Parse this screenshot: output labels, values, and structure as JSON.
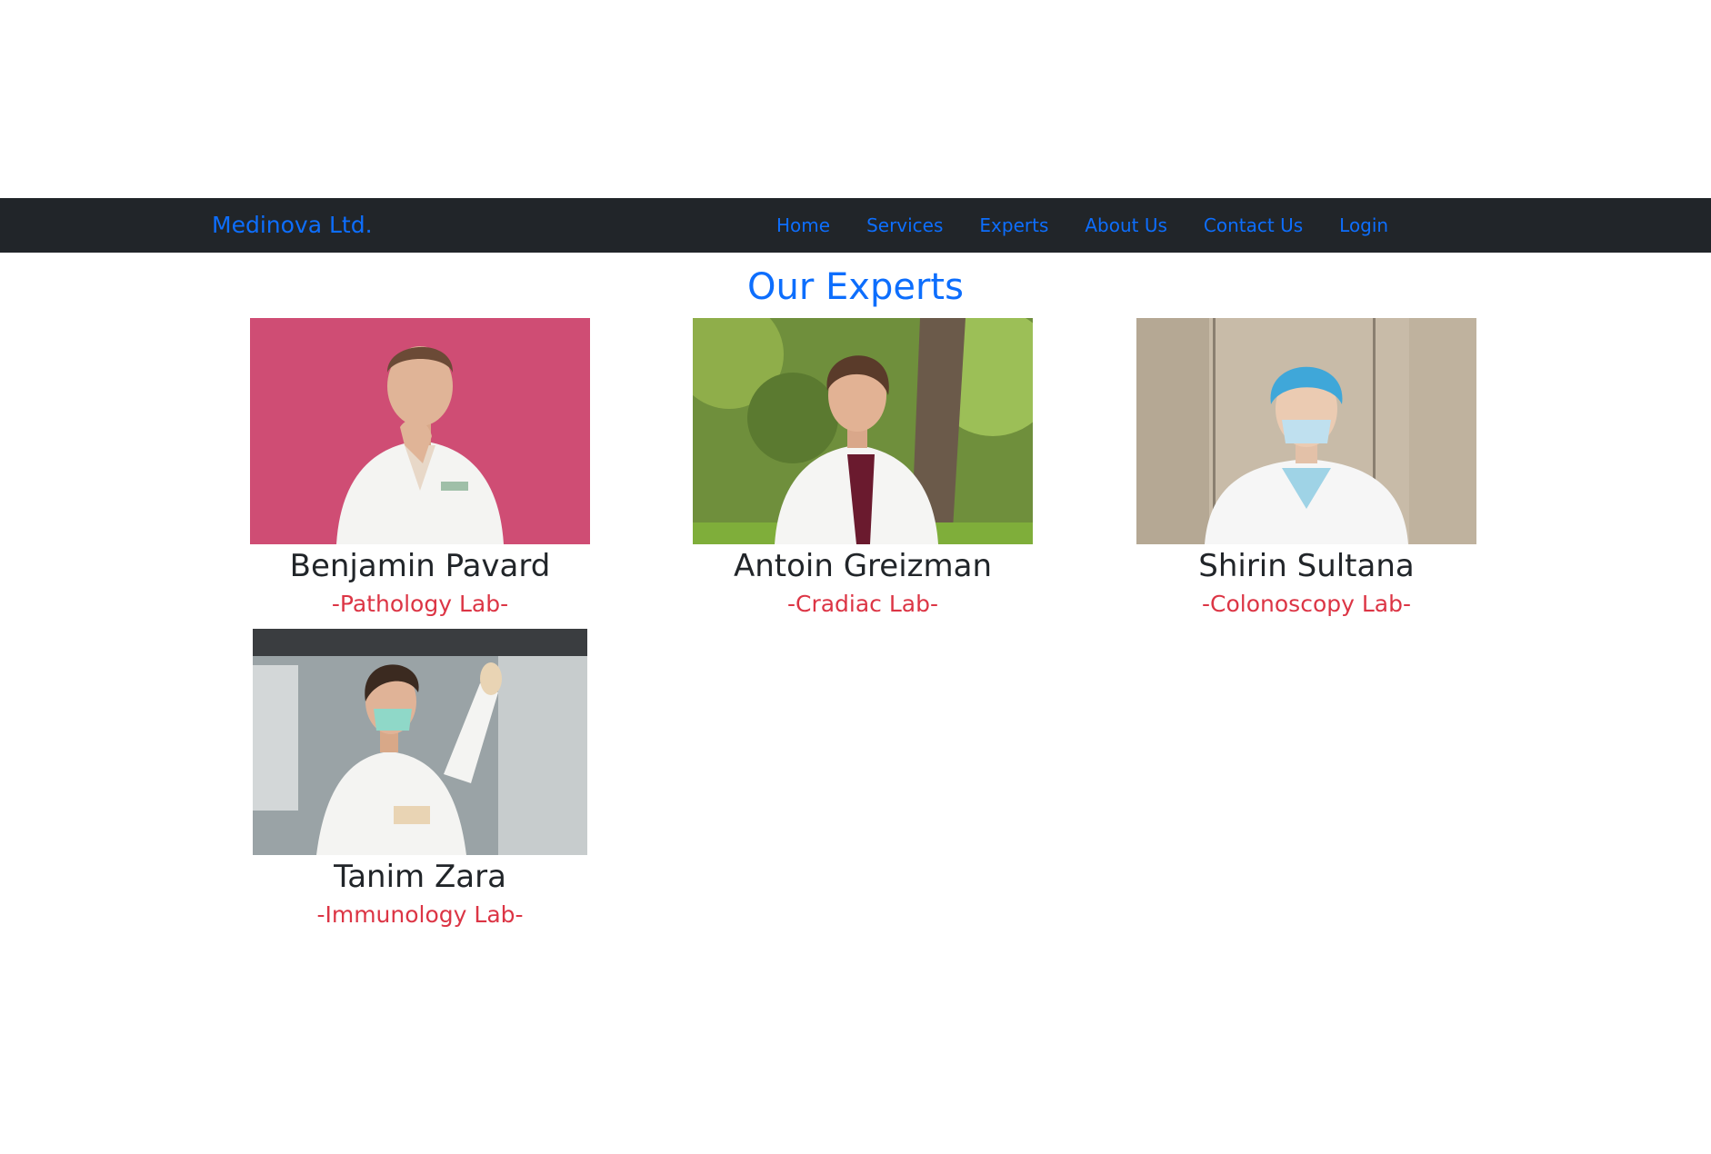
{
  "navbar": {
    "brand": "Medinova Ltd.",
    "links": [
      {
        "label": "Home"
      },
      {
        "label": "Services"
      },
      {
        "label": "Experts"
      },
      {
        "label": "About Us"
      },
      {
        "label": "Contact Us"
      },
      {
        "label": "Login"
      }
    ]
  },
  "section": {
    "title": "Our Experts"
  },
  "experts": [
    {
      "name": "Benjamin Pavard",
      "lab": "-Pathology Lab-"
    },
    {
      "name": "Antoin Greizman",
      "lab": "-Cradiac Lab-"
    },
    {
      "name": "Shirin Sultana",
      "lab": "-Colonoscopy Lab-"
    },
    {
      "name": "Tanim Zara",
      "lab": "-Immunology Lab-"
    }
  ],
  "colors": {
    "navbar_bg": "#212529",
    "link": "#0d6efd",
    "name_text": "#212529",
    "lab_text": "#dc3545"
  }
}
